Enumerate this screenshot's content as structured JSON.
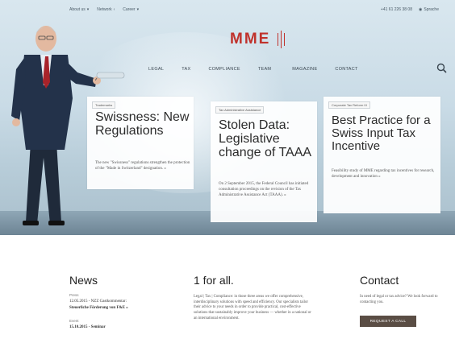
{
  "topbar": {
    "about": "About us",
    "network": "Network",
    "career": "Career",
    "phone": "+41 61 226 38 08",
    "language": "Sprache"
  },
  "brand": {
    "logo": "MME"
  },
  "nav": {
    "items": [
      "LEGAL",
      "TAX",
      "COMPLIANCE",
      "TEAM",
      "MAGAZINE",
      "CONTACT"
    ]
  },
  "cards": [
    {
      "tag": "Trademarks",
      "title": "Swissness: New Regulations",
      "text": "The new \"Swissness\" regulations strengthen the protection of the \"Made in Switzerland\" designation. »"
    },
    {
      "tag": "Tax Administrative Assistance",
      "title": "Stolen Data: Legislative change of TAAA",
      "text": "On 2 September 2015, the Federal Council has initiated consultation proceedings on the revision of the Tax Administrative Assistance Act (TAAA). »"
    },
    {
      "tag": "Corporate Tax Reform III",
      "title": "Best Practice for a Swiss Input Tax Incentive",
      "text": "Feasibility study of MME regarding tax incentives for research, development and innovation »"
    }
  ],
  "news": {
    "title": "News",
    "items": [
      {
        "label": "Press",
        "line1": "12.05.2015 - NZZ Gastkommentar:",
        "line2": "Steuerliche Förderung von F&E »"
      },
      {
        "label": "Event",
        "line1": "15.10.2015 - Seminar",
        "line2": ""
      }
    ]
  },
  "forall": {
    "title": "1 for all.",
    "text": "Legal | Tax | Compliance: in those three areas we offer comprehensive, interdisciplinary solutions with speed and efficiency. Our specialists tailor their advice to your needs in order to provide practical, cost-effective solutions that sustainably improve your business — whether in a national or an international environment."
  },
  "contact": {
    "title": "Contact",
    "text": "In need of legal or tax advice? We look forward to contacting you.",
    "button": "REQUEST A CALL"
  },
  "colors": {
    "brand": "#c0322c",
    "button": "#5a4d44"
  }
}
